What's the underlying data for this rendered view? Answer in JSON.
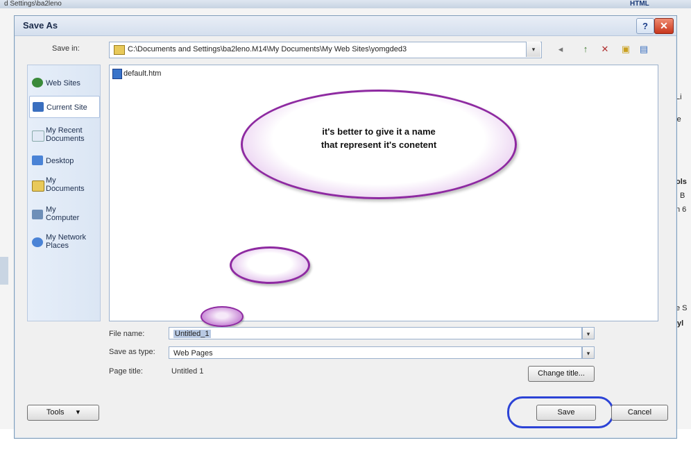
{
  "background": {
    "title_fragment": "d Settings\\ba2leno",
    "html_tag": "HTML",
    "right_fragments": [
      "Li",
      "re",
      "ols",
      "B",
      "n 6",
      "e S",
      "yl"
    ]
  },
  "dialog": {
    "title": "Save As",
    "help_label": "?",
    "close_label": "✕"
  },
  "save_in": {
    "label": "Save in:",
    "path": "C:\\Documents and Settings\\ba2leno.M14\\My Documents\\My Web Sites\\yomgded3",
    "dropdown_glyph": "▾"
  },
  "toolbar": {
    "icons": [
      "back-icon",
      "up-folder-icon",
      "delete-icon",
      "new-folder-icon",
      "views-icon"
    ],
    "glyphs": [
      "◂",
      "↑",
      "✕",
      "▣",
      "▤"
    ]
  },
  "places": [
    {
      "label": "Web Sites",
      "icon": "globe-icon",
      "color": "#3a8a3a"
    },
    {
      "label": "Current Site",
      "icon": "current-site-icon",
      "color": "#3a6fbf"
    },
    {
      "label": "My Recent Documents",
      "icon": "recent-documents-icon",
      "color": "#e1e9f5"
    },
    {
      "label": "Desktop",
      "icon": "desktop-icon",
      "color": "#4a83d6"
    },
    {
      "label": "My Documents",
      "icon": "folder-icon",
      "color": "#e8c95a"
    },
    {
      "label": "My Computer",
      "icon": "computer-icon",
      "color": "#6e8fb8"
    },
    {
      "label": "My Network Places",
      "icon": "network-icon",
      "color": "#4a83d6"
    }
  ],
  "file_list": {
    "items": [
      {
        "name": "default.htm",
        "icon": "html-file-icon"
      }
    ]
  },
  "annotation": {
    "callout_line1": "it's better to give it a name",
    "callout_line2": "that represent it's conetent"
  },
  "fields": {
    "file_name_label": "File name:",
    "file_name_value": "Untitled_1",
    "save_type_label": "Save as type:",
    "save_type_value": "Web Pages",
    "page_title_label": "Page title:",
    "page_title_value": "Untitled 1",
    "change_title_label": "Change title..."
  },
  "buttons": {
    "tools_label": "Tools",
    "tools_arrow": "▾",
    "save_label": "Save",
    "cancel_label": "Cancel"
  },
  "colors": {
    "callout_border": "#8e2aa1",
    "save_highlight": "#2c43d6"
  }
}
